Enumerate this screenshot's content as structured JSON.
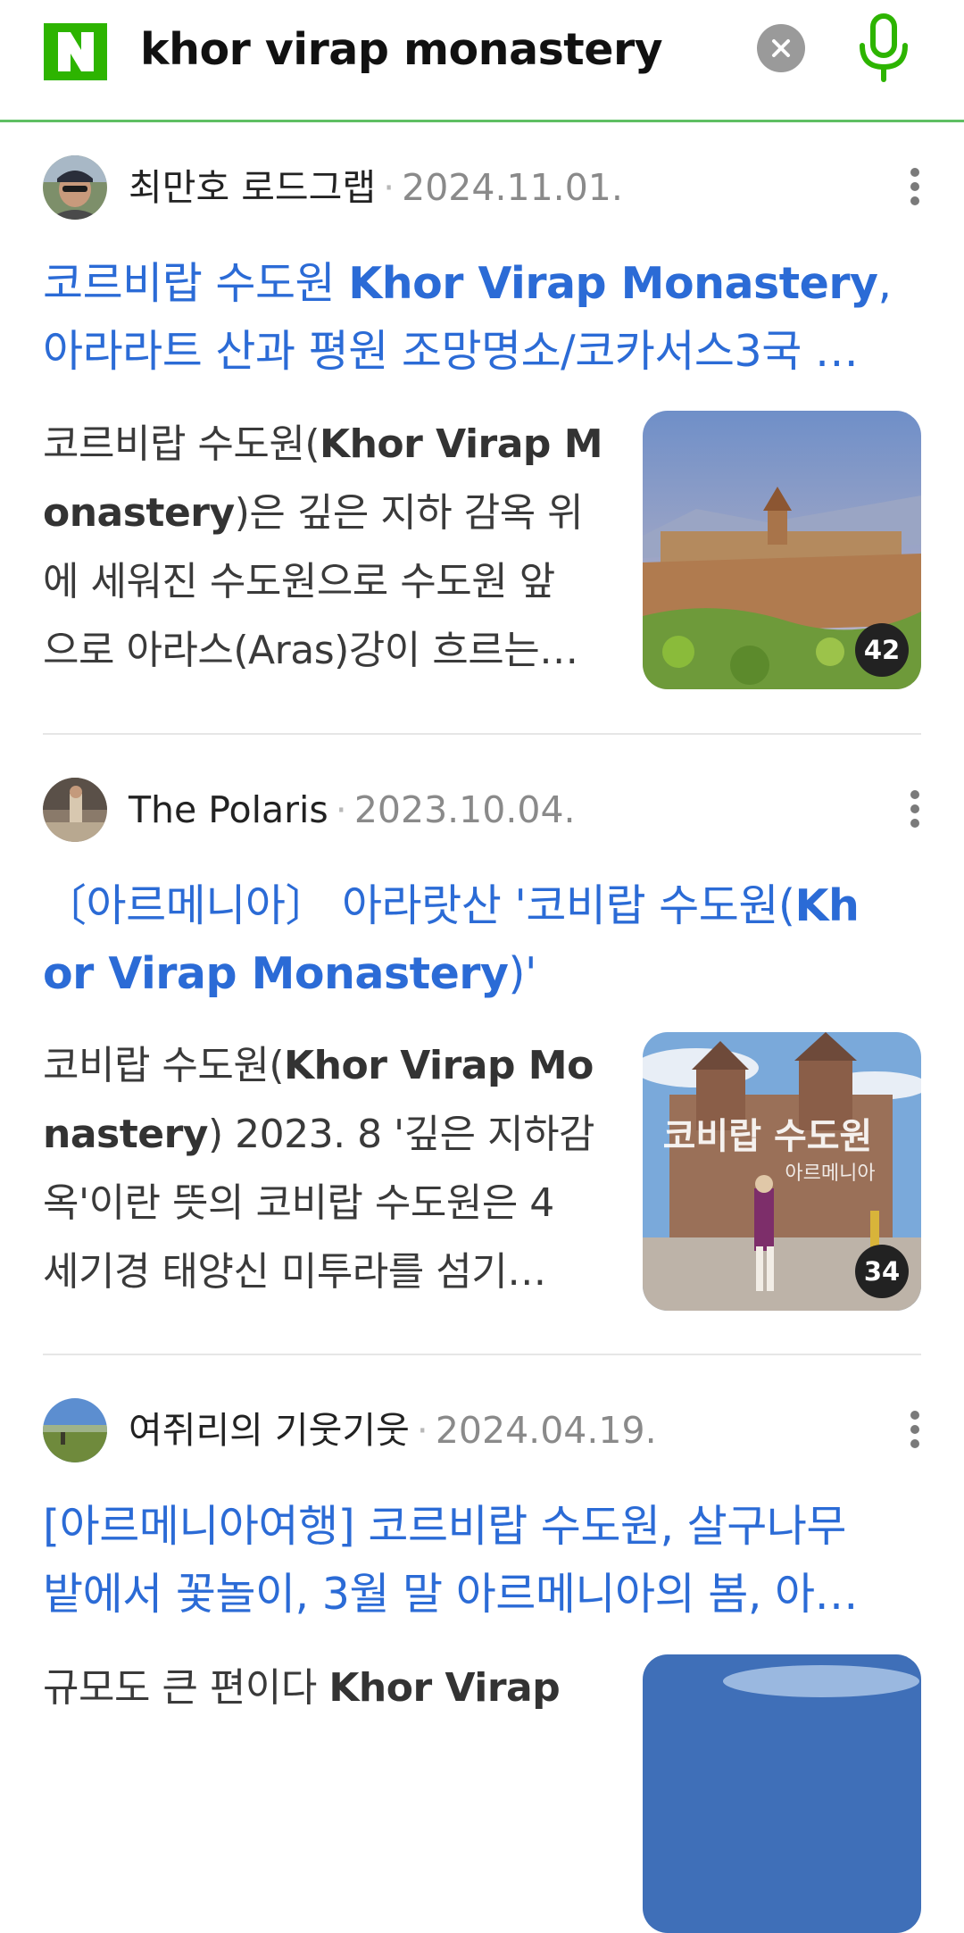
{
  "search": {
    "query": "khor virap monastery"
  },
  "results": [
    {
      "author": "최만호 로드그랩",
      "separator": "·",
      "date": "2024.11.01.",
      "title_lines": [
        [
          {
            "t": "코르비랍 수도원 ",
            "b": false
          },
          {
            "t": "Khor Virap Monastery",
            "b": true
          },
          {
            "t": ",",
            "b": false
          }
        ],
        [
          {
            "t": "아라라트 산과 평원 조망명소/코카서스3국 …",
            "b": false
          }
        ]
      ],
      "snippet_lines": [
        [
          {
            "t": "코르비랍 수도원(",
            "b": false
          },
          {
            "t": "Khor Virap M",
            "b": true
          }
        ],
        [
          {
            "t": "onastery",
            "b": true
          },
          {
            "t": ")은 깊은 지하 감옥 위",
            "b": false
          }
        ],
        [
          {
            "t": "에 세워진 수도원으로 수도원 앞",
            "b": false
          }
        ],
        [
          {
            "t": "으로 아라스(Aras)강이 흐르는…",
            "b": false
          }
        ]
      ],
      "image_count": "42"
    },
    {
      "author": "The Polaris",
      "separator": "·",
      "date": "2023.10.04.",
      "title_lines": [
        [
          {
            "t": "〔아르메니아〕 아라랏산 '코비랍 수도원(",
            "b": false
          },
          {
            "t": "Kh",
            "b": true
          }
        ],
        [
          {
            "t": "or Virap Monastery",
            "b": true
          },
          {
            "t": ")'",
            "b": false
          }
        ]
      ],
      "snippet_lines": [
        [
          {
            "t": "코비랍 수도원(",
            "b": false
          },
          {
            "t": "Khor Virap Mo",
            "b": true
          }
        ],
        [
          {
            "t": "nastery",
            "b": true
          },
          {
            "t": ") 2023. 8 '깊은 지하감",
            "b": false
          }
        ],
        [
          {
            "t": "옥'이란 뜻의 코비랍 수도원은 4",
            "b": false
          }
        ],
        [
          {
            "t": "세기경 태양신 미투라를 섬기…",
            "b": false
          }
        ]
      ],
      "image_count": "34",
      "image_caption": "코비랍 수도원",
      "image_subcaption": "아르메니아"
    },
    {
      "author": "여쥐리의 기웃기웃",
      "separator": "·",
      "date": "2024.04.19.",
      "title_lines": [
        [
          {
            "t": "[아르메니아여행] 코르비랍 수도원, 살구나무",
            "b": false
          }
        ],
        [
          {
            "t": "밭에서 꽃놀이, 3월 말 아르메니아의 봄, 아…",
            "b": false
          }
        ]
      ],
      "snippet_lines": [
        [
          {
            "t": "규모도 큰 편이다 ",
            "b": false
          },
          {
            "t": "Khor Virap",
            "b": true
          }
        ]
      ]
    }
  ],
  "colors": {
    "brand_green": "#2db400",
    "title_blue": "#2b6bd6",
    "divider": "#e6e6e6"
  },
  "icons": [
    "naver-logo-icon",
    "clear-icon",
    "mic-icon",
    "more-icon"
  ]
}
